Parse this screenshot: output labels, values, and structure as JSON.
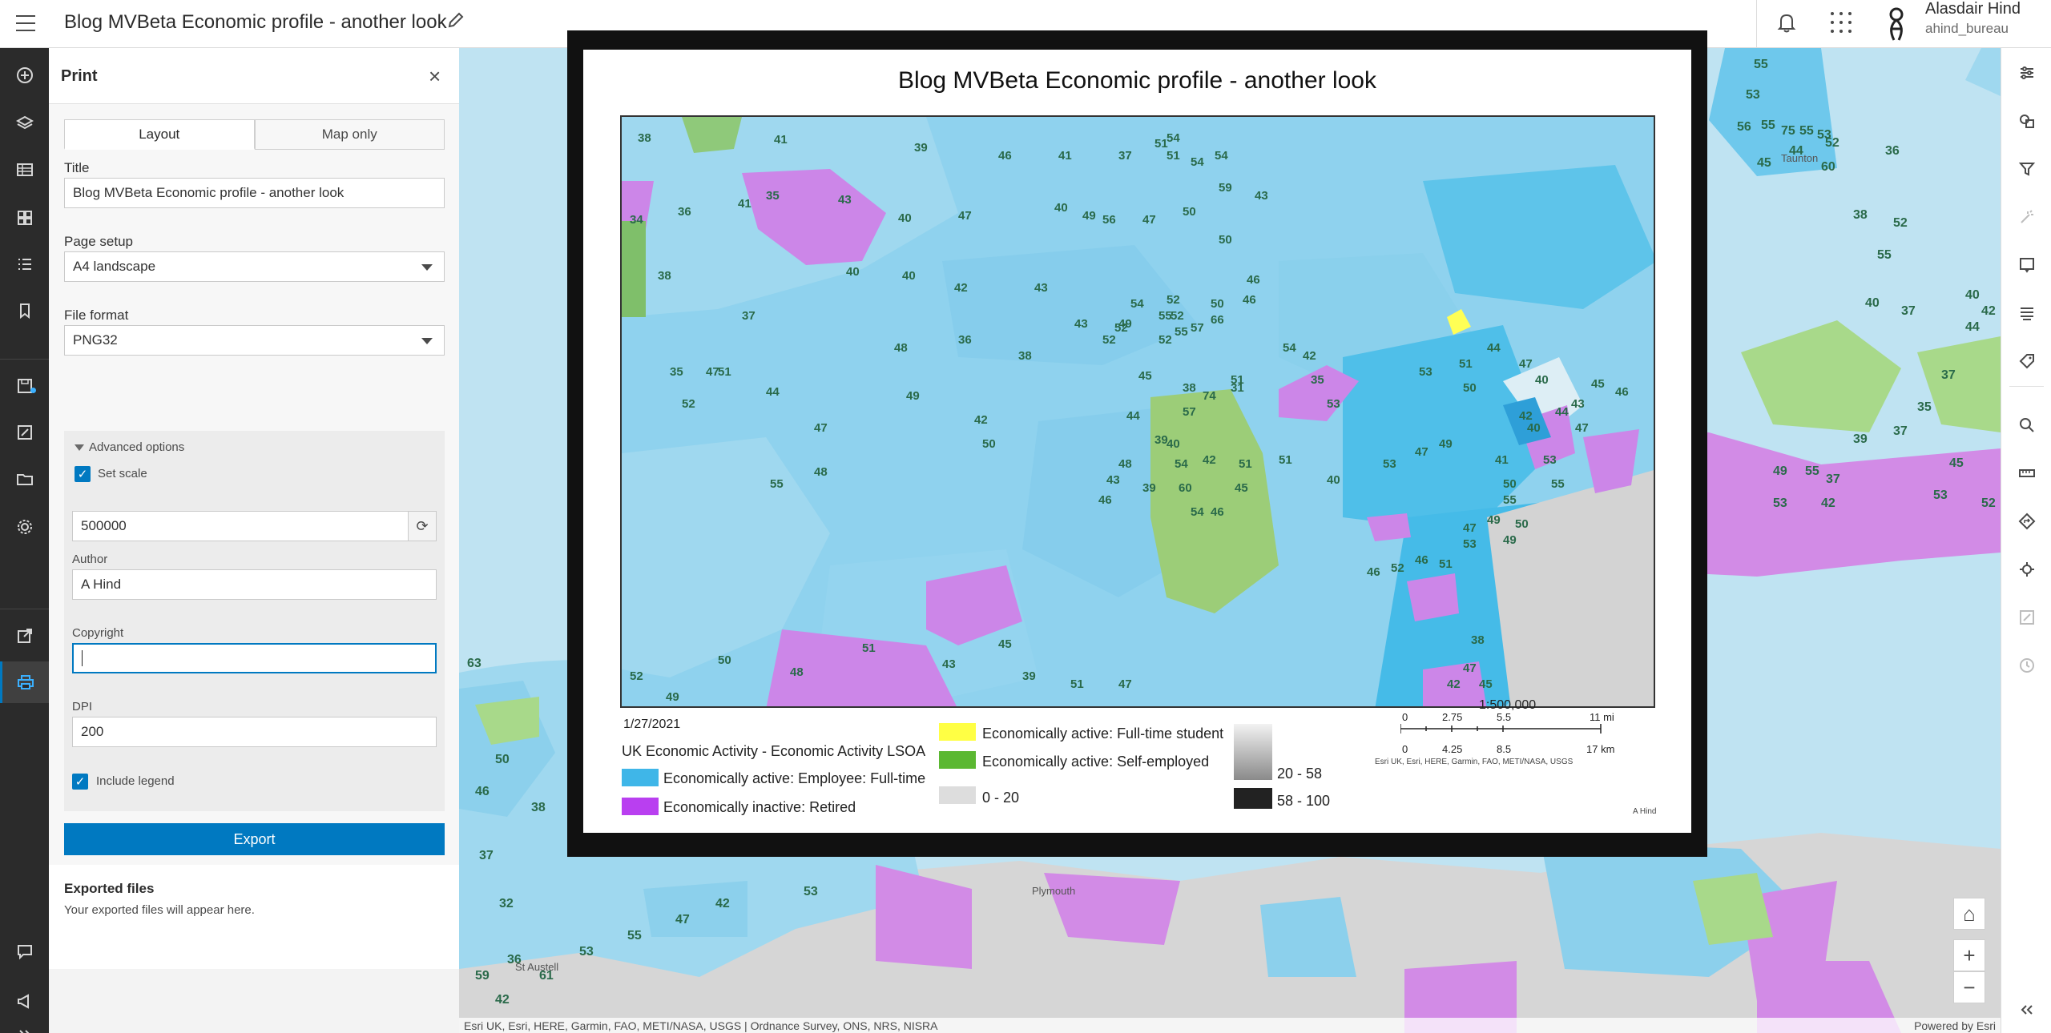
{
  "header": {
    "title": "Blog MVBeta Economic profile - another look",
    "user_name": "Alasdair Hind",
    "user_handle": "ahind_bureau"
  },
  "panel": {
    "title": "Print",
    "tabs": [
      "Layout",
      "Map only"
    ],
    "title_label": "Title",
    "title_value": "Blog MVBeta Economic profile - another look",
    "page_setup_label": "Page setup",
    "page_setup_value": "A4 landscape",
    "file_format_label": "File format",
    "file_format_value": "PNG32",
    "advanced_label": "Advanced options",
    "set_scale_label": "Set scale",
    "set_scale_checked": true,
    "scale_value": "500000",
    "author_label": "Author",
    "author_value": "A Hind",
    "copyright_label": "Copyright",
    "copyright_value": "",
    "dpi_label": "DPI",
    "dpi_value": "200",
    "include_legend_label": "Include legend",
    "include_legend_checked": true,
    "export_label": "Export",
    "exported_title": "Exported files",
    "exported_note": "Your exported files will appear here."
  },
  "map": {
    "attribution": "Esri UK, Esri, HERE, Garmin, FAO, METI/NASA, USGS | Ordnance Survey, ONS, NRS, NISRA",
    "powered_by": "Powered by Esri",
    "place_labels": [
      "Taunton",
      "Plymouth",
      "St Austell"
    ],
    "outer_values": [
      "55",
      "53",
      "55",
      "56",
      "75",
      "55",
      "53",
      "52",
      "44",
      "45",
      "60",
      "36",
      "38",
      "52",
      "55",
      "40",
      "37",
      "40",
      "42",
      "44",
      "37",
      "35",
      "37",
      "39",
      "37",
      "55",
      "49",
      "53",
      "42",
      "45",
      "53",
      "52",
      "63",
      "50",
      "46",
      "38",
      "37",
      "32",
      "36",
      "59",
      "42",
      "61",
      "53",
      "55",
      "47",
      "42",
      "53"
    ]
  },
  "preview": {
    "title": "Blog MVBeta Economic profile - another look",
    "date": "1/27/2021",
    "legend_title": "UK Economic Activity - Economic Activity LSOA",
    "legend_items": [
      {
        "label": "Economically active: Employee: Full-time",
        "color": "#3fb6e8"
      },
      {
        "label": "Economically inactive: Retired",
        "color": "#b93ff0"
      },
      {
        "label": "Economically active: Full-time student",
        "color": "#ffff44"
      },
      {
        "label": "Economically active: Self-employed",
        "color": "#5bb832"
      },
      {
        "label": "0 - 20",
        "color": "#dddddd"
      },
      {
        "label": "20 - 58",
        "color": "#8a8a8a"
      },
      {
        "label": "58 - 100",
        "color": "#222222"
      }
    ],
    "scale_label": "1:500,000",
    "scale_mi": [
      "0",
      "2.75",
      "5.5",
      "11 mi"
    ],
    "scale_km": [
      "0",
      "4.25",
      "8.5",
      "17 km"
    ],
    "credits": "Esri UK, Esri, HERE, Garmin, FAO, METI/NASA, USGS",
    "author": "A Hind",
    "map_values": [
      "38",
      "41",
      "39",
      "46",
      "41",
      "37",
      "54",
      "54",
      "51",
      "51",
      "54",
      "59",
      "36",
      "41",
      "35",
      "43",
      "40",
      "47",
      "50",
      "43",
      "34",
      "40",
      "49",
      "56",
      "47",
      "50",
      "40",
      "40",
      "46",
      "38",
      "42",
      "43",
      "43",
      "54",
      "52",
      "52",
      "52",
      "49",
      "57",
      "55",
      "55",
      "66",
      "37",
      "36",
      "48",
      "38",
      "52",
      "52",
      "46",
      "35",
      "44",
      "47",
      "54",
      "45",
      "50",
      "42",
      "38",
      "31",
      "51",
      "57",
      "49",
      "52",
      "47",
      "50",
      "51",
      "42",
      "74",
      "39",
      "44",
      "35",
      "40",
      "53",
      "53",
      "51",
      "50",
      "44",
      "47",
      "40",
      "55",
      "48",
      "43",
      "39",
      "60",
      "54",
      "54",
      "46",
      "45",
      "48",
      "46",
      "42",
      "51",
      "51",
      "40",
      "53",
      "47",
      "49",
      "41",
      "50",
      "55",
      "49",
      "47",
      "42",
      "40",
      "47",
      "45",
      "46",
      "43",
      "44",
      "53",
      "55",
      "50",
      "49",
      "53",
      "51",
      "46",
      "52",
      "46",
      "45",
      "38",
      "47",
      "45",
      "42",
      "52",
      "49",
      "50",
      "48",
      "51",
      "43",
      "39",
      "51",
      "47"
    ]
  }
}
